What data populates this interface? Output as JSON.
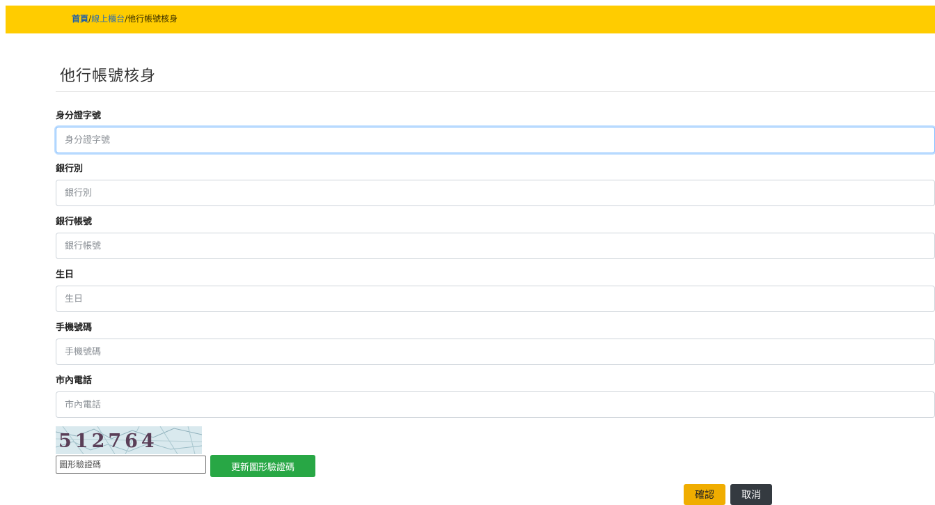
{
  "breadcrumb": {
    "home": "首頁",
    "separator": "/",
    "section": "線上櫃台",
    "current": "他行帳號核身"
  },
  "page_title": "他行帳號核身",
  "form": {
    "id_number": {
      "label": "身分證字號",
      "placeholder": "身分證字號"
    },
    "bank": {
      "label": "銀行別",
      "placeholder": "銀行別"
    },
    "account": {
      "label": "銀行帳號",
      "placeholder": "銀行帳號"
    },
    "birthday": {
      "label": "生日",
      "placeholder": "生日"
    },
    "mobile": {
      "label": "手機號碼",
      "placeholder": "手機號碼"
    },
    "phone": {
      "label": "市內電話",
      "placeholder": "市內電話"
    }
  },
  "captcha": {
    "image_text": "512764",
    "input_placeholder": "圖形驗證碼",
    "refresh_label": "更新圖形驗證碼"
  },
  "actions": {
    "confirm_label": "確認",
    "cancel_label": "取消"
  },
  "colors": {
    "topbar": "#ffcc00",
    "refresh_button": "#28a745",
    "confirm_button": "#f0ad00",
    "cancel_button": "#343a40"
  }
}
